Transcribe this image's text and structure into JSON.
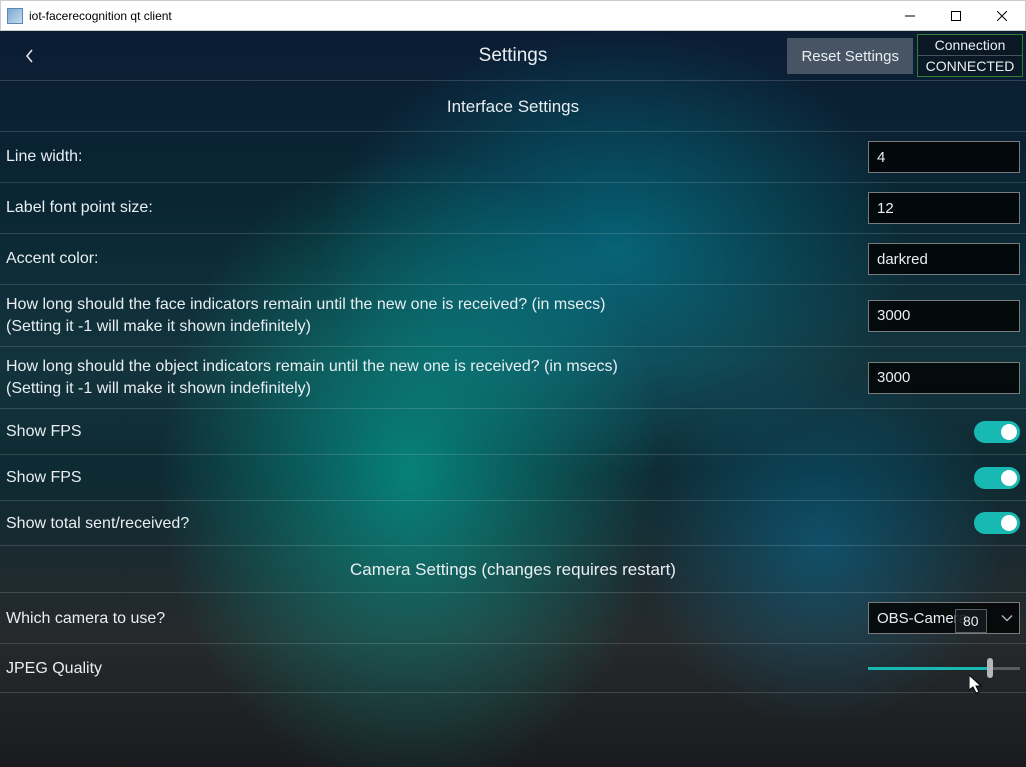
{
  "window": {
    "title": "iot-facerecognition qt client"
  },
  "header": {
    "title": "Settings",
    "reset_label": "Reset Settings",
    "connection_label": "Connection",
    "connection_status": "CONNECTED"
  },
  "interface_section": {
    "title": "Interface Settings",
    "line_width": {
      "label": "Line width:",
      "value": "4"
    },
    "label_font": {
      "label": "Label font point size:",
      "value": "12"
    },
    "accent_color": {
      "label": "Accent color:",
      "value": "darkred"
    },
    "face_timeout": {
      "label": "How long should the face indicators remain until the new one is received? (in msecs)\n  (Setting it -1 will make it shown indefinitely)",
      "value": "3000"
    },
    "object_timeout": {
      "label": "How long should the object indicators remain until the new one is received? (in msecs)\n  (Setting it -1 will make it shown indefinitely)",
      "value": "3000"
    },
    "show_fps_1": {
      "label": "Show FPS",
      "on": true
    },
    "show_fps_2": {
      "label": "Show FPS",
      "on": true
    },
    "show_totals": {
      "label": "Show total sent/received?",
      "on": true
    }
  },
  "camera_section": {
    "title": "Camera Settings (changes requires restart)",
    "which_camera": {
      "label": "Which camera to use?",
      "value": "OBS-Camera"
    },
    "jpeg_quality": {
      "label": "JPEG Quality",
      "value": 80,
      "min": 0,
      "max": 100
    }
  },
  "colors": {
    "accent": "#18b9b2",
    "connected_border": "#2e7d32"
  }
}
